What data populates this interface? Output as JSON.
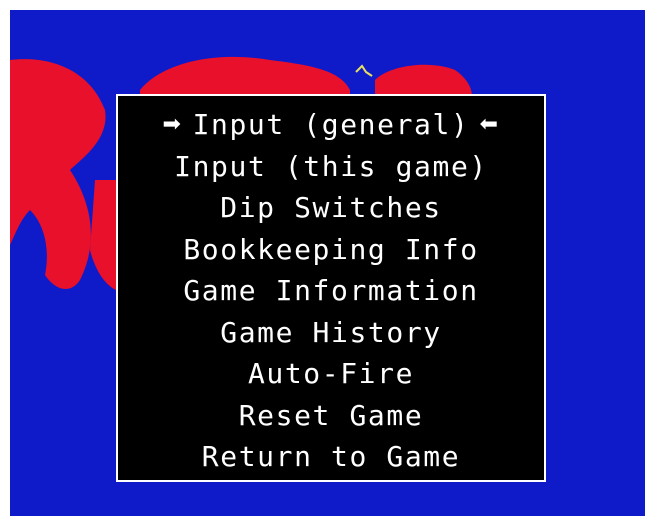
{
  "colors": {
    "screen_bg": "#0f1bc8",
    "art_red": "#e8102b",
    "menu_bg": "#000000",
    "menu_text": "#ffffff",
    "page_border": "#ffffff"
  },
  "menu": {
    "selected_index": 0,
    "cursor_left_icon": "right-arrow-icon",
    "cursor_right_icon": "left-arrow-icon",
    "items": [
      {
        "label": "Input (general)"
      },
      {
        "label": "Input (this game)"
      },
      {
        "label": "Dip Switches"
      },
      {
        "label": "Bookkeeping Info"
      },
      {
        "label": "Game Information"
      },
      {
        "label": "Game History"
      },
      {
        "label": "Auto-Fire"
      },
      {
        "label": "Reset Game"
      },
      {
        "label": "Return to Game"
      }
    ]
  }
}
